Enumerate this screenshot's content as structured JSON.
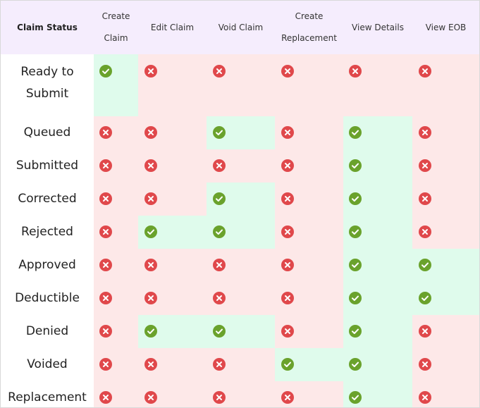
{
  "table": {
    "columns": [
      {
        "lines": [
          "Claim Status"
        ]
      },
      {
        "lines": [
          "Create",
          "Claim"
        ]
      },
      {
        "lines": [
          "Edit Claim"
        ]
      },
      {
        "lines": [
          "Void Claim"
        ]
      },
      {
        "lines": [
          "Create",
          "Replacement"
        ]
      },
      {
        "lines": [
          "View Details"
        ]
      },
      {
        "lines": [
          "View EOB"
        ]
      }
    ],
    "rows": [
      {
        "status_lines": [
          "Ready to",
          "Submit"
        ],
        "permissions": [
          "allowed",
          "denied",
          "denied",
          "denied",
          "denied",
          "denied"
        ]
      },
      {
        "status_lines": [
          "Queued"
        ],
        "permissions": [
          "denied",
          "denied",
          "allowed",
          "denied",
          "allowed",
          "denied"
        ]
      },
      {
        "status_lines": [
          "Submitted"
        ],
        "permissions": [
          "denied",
          "denied",
          "denied",
          "denied",
          "allowed",
          "denied"
        ]
      },
      {
        "status_lines": [
          "Corrected"
        ],
        "permissions": [
          "denied",
          "denied",
          "allowed",
          "denied",
          "allowed",
          "denied"
        ]
      },
      {
        "status_lines": [
          "Rejected"
        ],
        "permissions": [
          "denied",
          "allowed",
          "allowed",
          "denied",
          "allowed",
          "denied"
        ]
      },
      {
        "status_lines": [
          "Approved"
        ],
        "permissions": [
          "denied",
          "denied",
          "denied",
          "denied",
          "allowed",
          "allowed"
        ]
      },
      {
        "status_lines": [
          "Deductible"
        ],
        "permissions": [
          "denied",
          "denied",
          "denied",
          "denied",
          "allowed",
          "allowed"
        ]
      },
      {
        "status_lines": [
          "Denied"
        ],
        "permissions": [
          "denied",
          "allowed",
          "allowed",
          "denied",
          "allowed",
          "denied"
        ]
      },
      {
        "status_lines": [
          "Voided"
        ],
        "permissions": [
          "denied",
          "denied",
          "denied",
          "allowed",
          "allowed",
          "denied"
        ]
      },
      {
        "status_lines": [
          "Replacement"
        ],
        "permissions": [
          "denied",
          "denied",
          "denied",
          "denied",
          "allowed",
          "denied"
        ]
      }
    ]
  },
  "icons": {
    "allowed": "check-circle-icon",
    "denied": "x-circle-icon"
  },
  "colors": {
    "header_bg": "#f5edfd",
    "allowed_cell_bg": "#dffbec",
    "denied_cell_bg": "#fde8e8",
    "allowed_icon": "#6aa22c",
    "denied_icon": "#e0484b"
  }
}
